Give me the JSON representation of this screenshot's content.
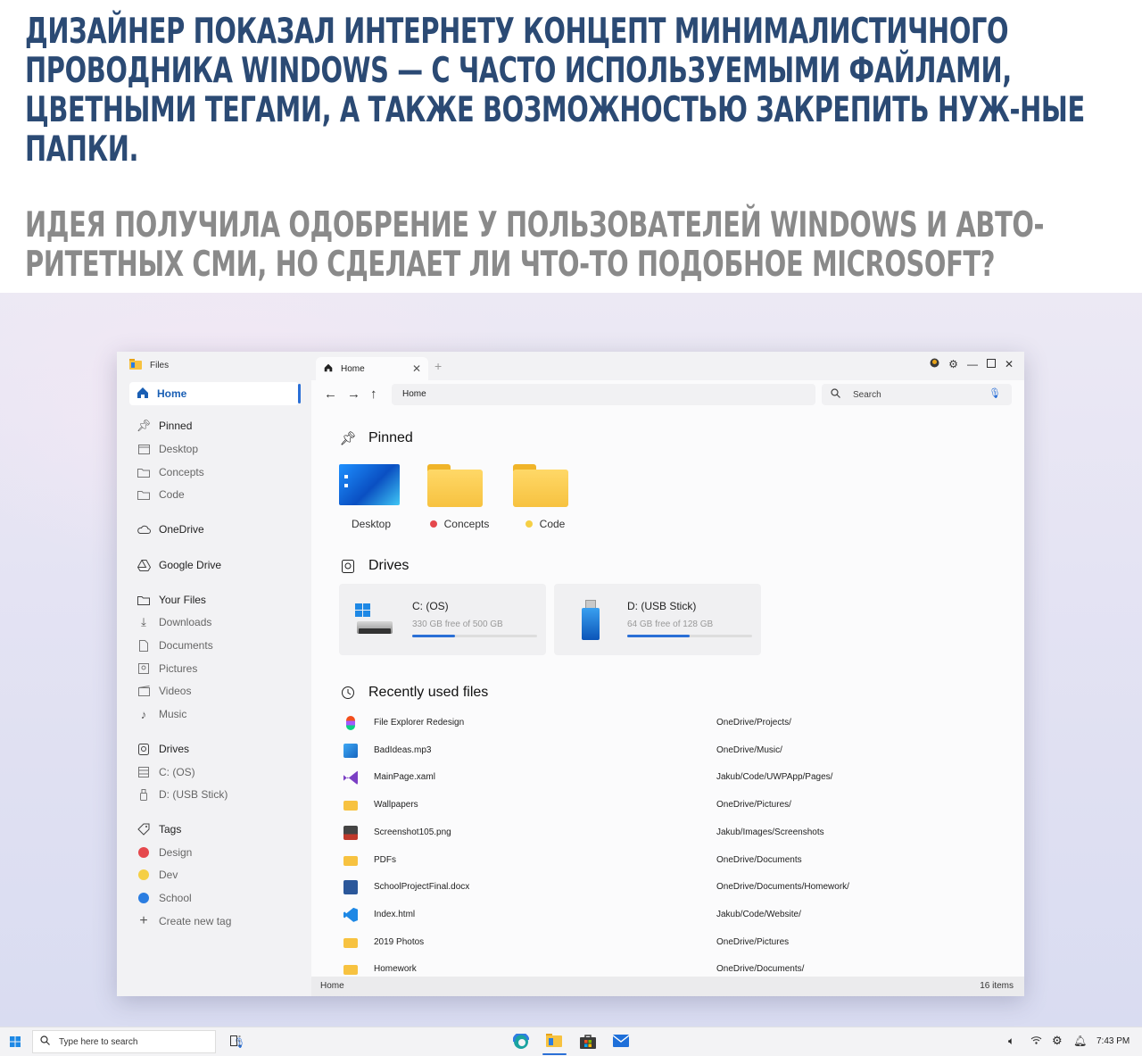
{
  "article": {
    "headline": "ДИЗАЙНЕР ПОКАЗАЛ ИНТЕРНЕТУ КОНЦЕПТ МИНИМАЛИСТИЧНОГО ПРОВОДНИКА WINDOWS — С ЧАСТО ИСПОЛЬЗУЕМЫМИ ФАЙЛАМИ, ЦВЕТНЫМИ ТЕГАМИ, А ТАКЖЕ ВОЗМОЖНОСТЬЮ ЗАКРЕПИТЬ НУЖ-НЫЕ ПАПКИ.",
    "subline": "ИДЕЯ ПОЛУЧИЛА ОДОБРЕНИЕ У ПОЛЬЗОВАТЕЛЕЙ WINDOWS И АВТО-РИТЕТНЫХ СМИ, НО СДЕЛАЕТ ЛИ ЧТО-ТО ПОДОБНОЕ MICROSOFT?"
  },
  "window": {
    "app_title": "Files",
    "tab_label": "Home",
    "address": "Home",
    "search_placeholder": "Search",
    "status_left": "Home",
    "status_right": "16 items"
  },
  "sidebar": {
    "home": "Home",
    "pinned": "Pinned",
    "pinned_items": [
      "Desktop",
      "Concepts",
      "Code"
    ],
    "onedrive": "OneDrive",
    "google_drive": "Google Drive",
    "your_files": "Your Files",
    "your_files_items": [
      "Downloads",
      "Documents",
      "Pictures",
      "Videos",
      "Music"
    ],
    "drives": "Drives",
    "drive_items": [
      "C: (OS)",
      "D: (USB Stick)"
    ],
    "tags": "Tags",
    "tag_items": [
      {
        "label": "Design",
        "color": "#e5484d"
      },
      {
        "label": "Dev",
        "color": "#f5cf45"
      },
      {
        "label": "School",
        "color": "#2a7de1"
      }
    ],
    "create_tag": "Create new tag"
  },
  "main": {
    "pinned_title": "Pinned",
    "pinned": [
      {
        "label": "Desktop"
      },
      {
        "label": "Concepts",
        "tag_color": "#e5484d"
      },
      {
        "label": "Code",
        "tag_color": "#f5cf45"
      }
    ],
    "drives_title": "Drives",
    "drives": [
      {
        "name": "C: (OS)",
        "free": "330 GB free of 500 GB",
        "used_fraction": 0.34
      },
      {
        "name": "D: (USB Stick)",
        "free": "64 GB free of 128 GB",
        "used_fraction": 0.5
      }
    ],
    "recent_title": "Recently used files",
    "recent": [
      {
        "name": "File Explorer Redesign",
        "path": "OneDrive/Projects/",
        "icon": "figma-icon"
      },
      {
        "name": "BadIdeas.mp3",
        "path": "OneDrive/Music/",
        "icon": "music-file-icon"
      },
      {
        "name": "MainPage.xaml",
        "path": "Jakub/Code/UWPApp/Pages/",
        "icon": "visual-studio-icon"
      },
      {
        "name": "Wallpapers",
        "path": "OneDrive/Pictures/",
        "icon": "folder-icon"
      },
      {
        "name": "Screenshot105.png",
        "path": "Jakub/Images/Screenshots",
        "icon": "image-file-icon"
      },
      {
        "name": "PDFs",
        "path": "OneDrive/Documents",
        "icon": "folder-icon"
      },
      {
        "name": "SchoolProjectFinal.docx",
        "path": "OneDrive/Documents/Homework/",
        "icon": "word-icon"
      },
      {
        "name": "Index.html",
        "path": "Jakub/Code/Website/",
        "icon": "vscode-icon"
      },
      {
        "name": "2019 Photos",
        "path": "OneDrive/Pictures",
        "icon": "folder-icon"
      },
      {
        "name": "Homework",
        "path": "OneDrive/Documents/",
        "icon": "folder-icon"
      }
    ]
  },
  "taskbar": {
    "search_placeholder": "Type here to search",
    "time": "7:43 PM"
  }
}
